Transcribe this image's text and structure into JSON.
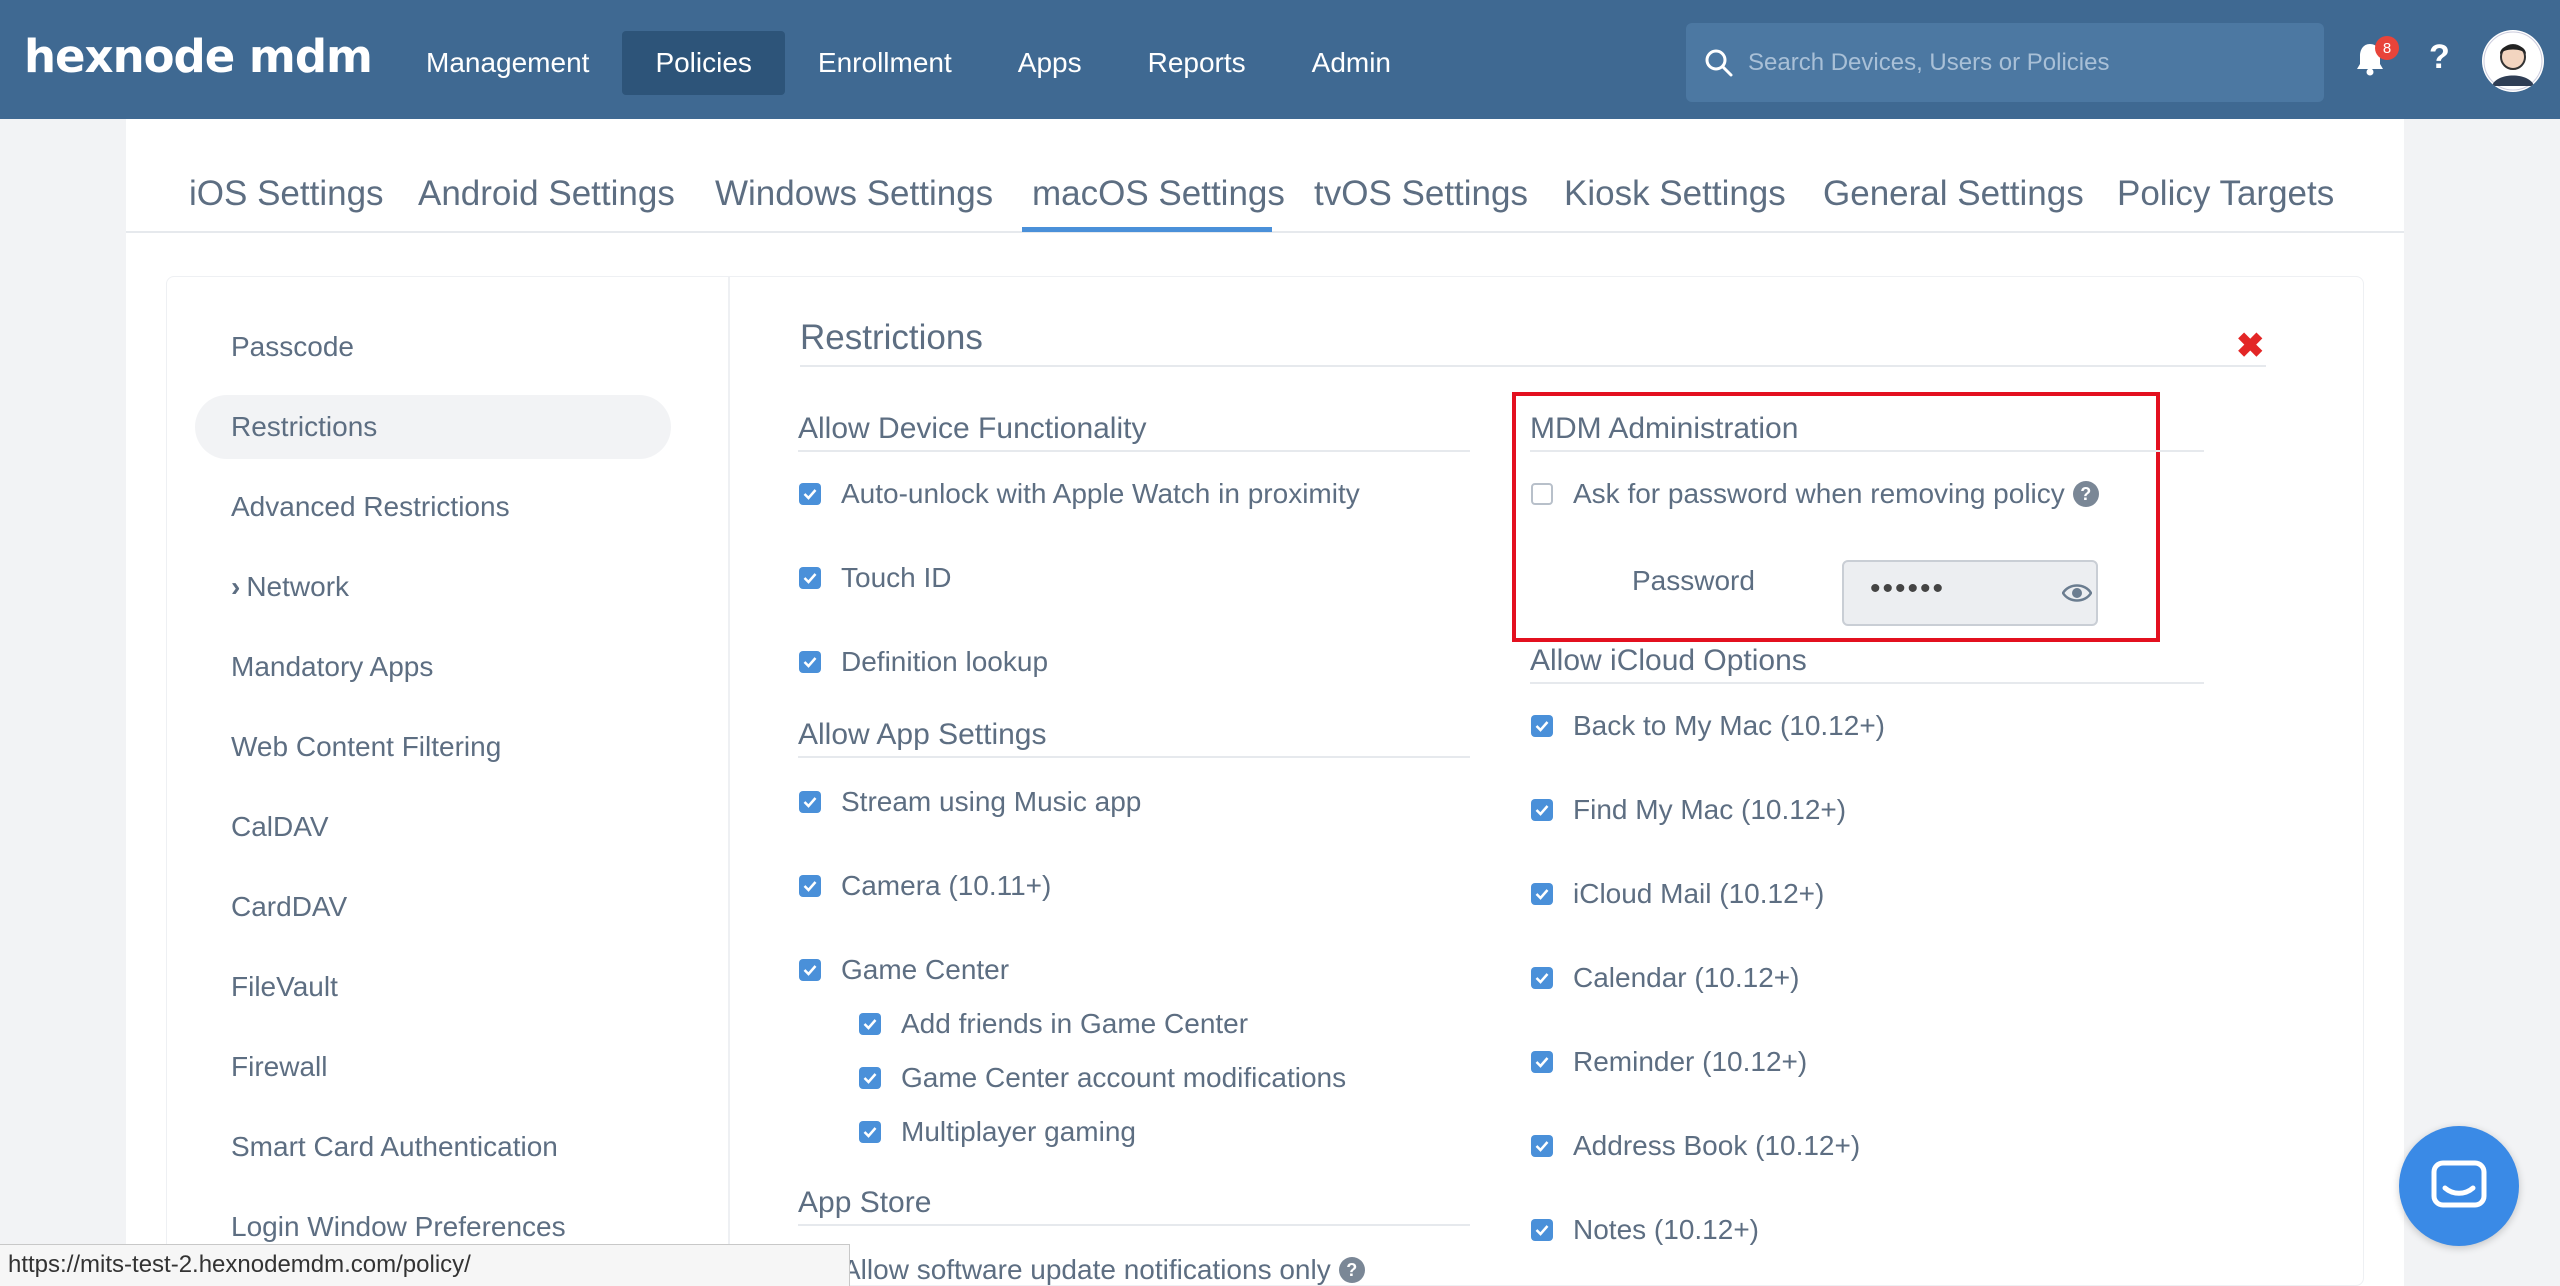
{
  "brand": {
    "logo": "hexnode mdm"
  },
  "nav": [
    {
      "label": "Management"
    },
    {
      "label": "Policies"
    },
    {
      "label": "Enrollment"
    },
    {
      "label": "Apps"
    },
    {
      "label": "Reports"
    },
    {
      "label": "Admin"
    }
  ],
  "search": {
    "placeholder": "Search Devices, Users or Policies"
  },
  "notifications": {
    "count": "8"
  },
  "help": {
    "label": "?"
  },
  "tabs": [
    {
      "label": "iOS Settings"
    },
    {
      "label": "Android Settings"
    },
    {
      "label": "Windows Settings"
    },
    {
      "label": "macOS Settings"
    },
    {
      "label": "tvOS Settings"
    },
    {
      "label": "Kiosk Settings"
    },
    {
      "label": "General Settings"
    },
    {
      "label": "Policy Targets"
    }
  ],
  "active_tab": "macOS Settings",
  "sidebar": {
    "items": [
      {
        "label": "Passcode"
      },
      {
        "label": "Restrictions"
      },
      {
        "label": "Advanced Restrictions"
      },
      {
        "label": "Network",
        "prefix": "›"
      },
      {
        "label": "Mandatory Apps"
      },
      {
        "label": "Web Content Filtering"
      },
      {
        "label": "CalDAV"
      },
      {
        "label": "CardDAV"
      },
      {
        "label": "FileVault"
      },
      {
        "label": "Firewall"
      },
      {
        "label": "Smart Card Authentication"
      },
      {
        "label": "Login Window Preferences"
      }
    ],
    "active": "Restrictions"
  },
  "content": {
    "title": "Restrictions",
    "close": "✖",
    "device_functionality": {
      "title": "Allow Device Functionality",
      "options": [
        {
          "label": "Auto-unlock with Apple Watch in proximity",
          "checked": true
        },
        {
          "label": "Touch ID",
          "checked": true
        },
        {
          "label": "Definition lookup",
          "checked": true
        }
      ]
    },
    "app_settings": {
      "title": "Allow App Settings",
      "options": [
        {
          "label": "Stream using Music app",
          "checked": true
        },
        {
          "label": "Camera (10.11+)",
          "checked": true
        },
        {
          "label": "Game Center",
          "checked": true
        },
        {
          "label": "Add friends in Game Center",
          "checked": true
        },
        {
          "label": "Game Center account modifications",
          "checked": true
        },
        {
          "label": "Multiplayer gaming",
          "checked": true
        }
      ]
    },
    "app_store": {
      "title": "App Store",
      "options": [
        {
          "label": "Allow software update notifications only",
          "checked": false
        }
      ]
    },
    "mdm_admin": {
      "title": "MDM Administration",
      "ask_password": {
        "label": "Ask for password when removing policy",
        "checked": false
      },
      "password_label": "Password",
      "password_value": "••••••"
    },
    "icloud": {
      "title": "Allow iCloud Options",
      "options": [
        {
          "label": "Back to My Mac (10.12+)",
          "checked": true
        },
        {
          "label": "Find My Mac (10.12+)",
          "checked": true
        },
        {
          "label": "iCloud Mail (10.12+)",
          "checked": true
        },
        {
          "label": "Calendar (10.12+)",
          "checked": true
        },
        {
          "label": "Reminder (10.12+)",
          "checked": true
        },
        {
          "label": "Address Book (10.12+)",
          "checked": true
        },
        {
          "label": "Notes (10.12+)",
          "checked": true
        }
      ]
    }
  },
  "status_url": "https://mits-test-2.hexnodemdm.com/policy/",
  "colors": {
    "topbar": "#3f6992",
    "accent": "#4a90d9",
    "highlight_box": "#e3101f",
    "close": "#e32626"
  },
  "icons": [
    "search-icon",
    "bell-icon",
    "help-icon",
    "avatar",
    "eye-icon",
    "close-icon",
    "chat-icon",
    "checkbox-checked"
  ]
}
